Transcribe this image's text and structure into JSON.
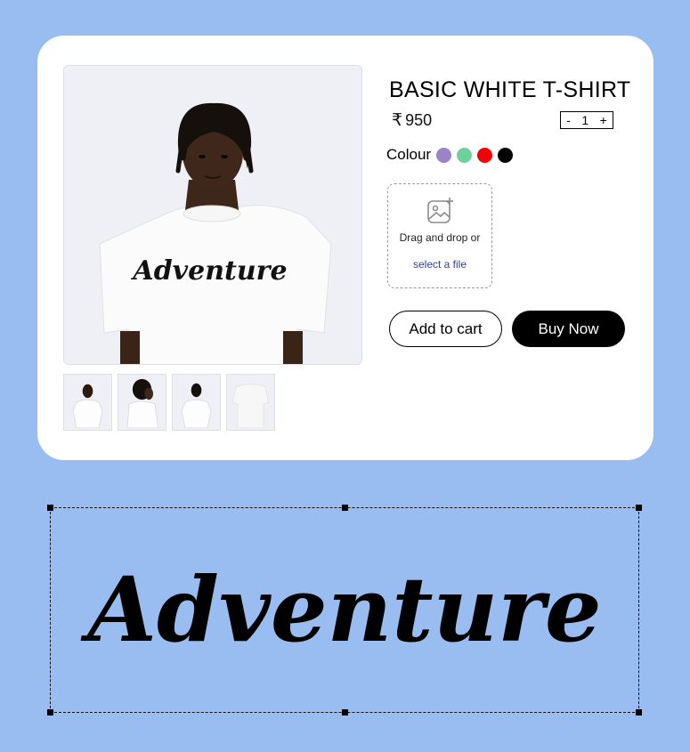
{
  "product": {
    "title": "BASIC WHITE T-SHIRT",
    "currency_symbol": "₹",
    "price": "950",
    "print_text": "Adventure"
  },
  "quantity": {
    "minus": "-",
    "value": "1",
    "plus": "+"
  },
  "colour": {
    "label": "Colour",
    "swatches": [
      "#9a83c9",
      "#6dd19b",
      "#f00000",
      "#000000"
    ]
  },
  "upload": {
    "icon": "image-add-icon",
    "drag_text": "Drag and drop or",
    "select_text": "select a file"
  },
  "actions": {
    "add_to_cart": "Add to cart",
    "buy_now": "Buy Now"
  },
  "canvas": {
    "text": "Adventure"
  }
}
